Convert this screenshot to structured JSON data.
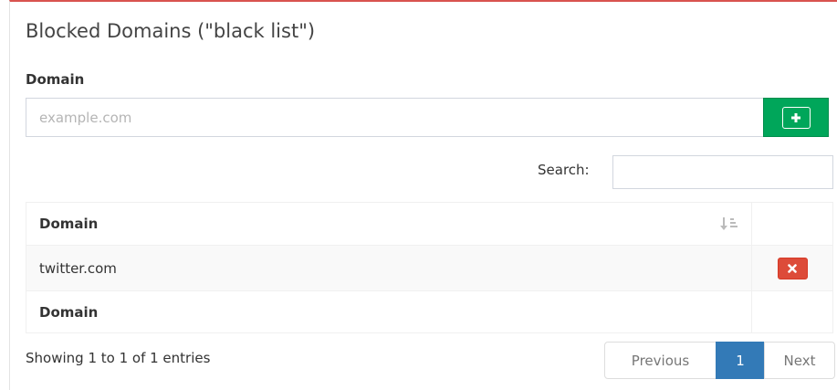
{
  "panel": {
    "title": "Blocked Domains (\"black list\")",
    "accent_color": "#d9534f"
  },
  "form": {
    "label": "Domain",
    "input_placeholder": "example.com",
    "input_value": "",
    "add_icon": "plus-icon",
    "add_color": "#00a65a"
  },
  "search": {
    "label": "Search:",
    "value": ""
  },
  "table": {
    "header": "Domain",
    "sort_icon": "sort-alpha-icon",
    "rows": [
      {
        "domain": "twitter.com",
        "delete_icon": "close-icon"
      }
    ],
    "footer": "Domain",
    "delete_color": "#dd4b39"
  },
  "footer": {
    "info": "Showing 1 to 1 of 1 entries",
    "previous_label": "Previous",
    "current_page": "1",
    "next_label": "Next",
    "page_color": "#337ab7"
  }
}
